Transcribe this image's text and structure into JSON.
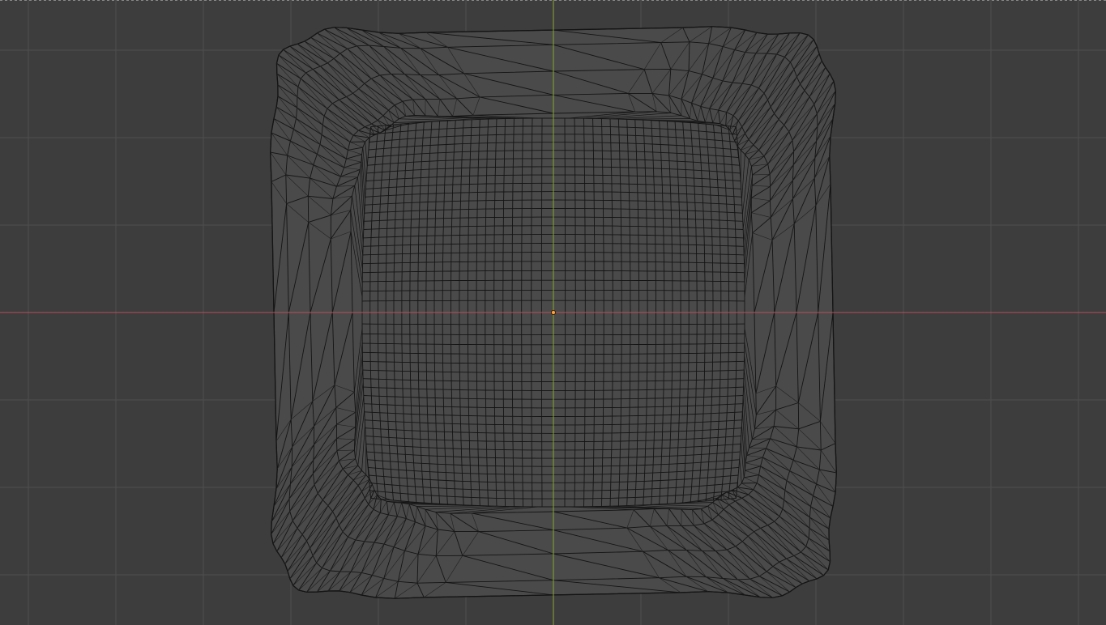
{
  "viewport": {
    "view": "top-orthographic",
    "shading": "wireframe",
    "mode": "object",
    "colors": {
      "background": "#3d3d3d",
      "grid_line": "#4f4f4f",
      "x_axis": "#b8505c",
      "y_axis": "#86a832",
      "wire": "#141414",
      "mesh_fill": "#4a4a4a",
      "origin": "#ffa03a"
    },
    "icons": {
      "origin": "object-origin-icon"
    }
  }
}
